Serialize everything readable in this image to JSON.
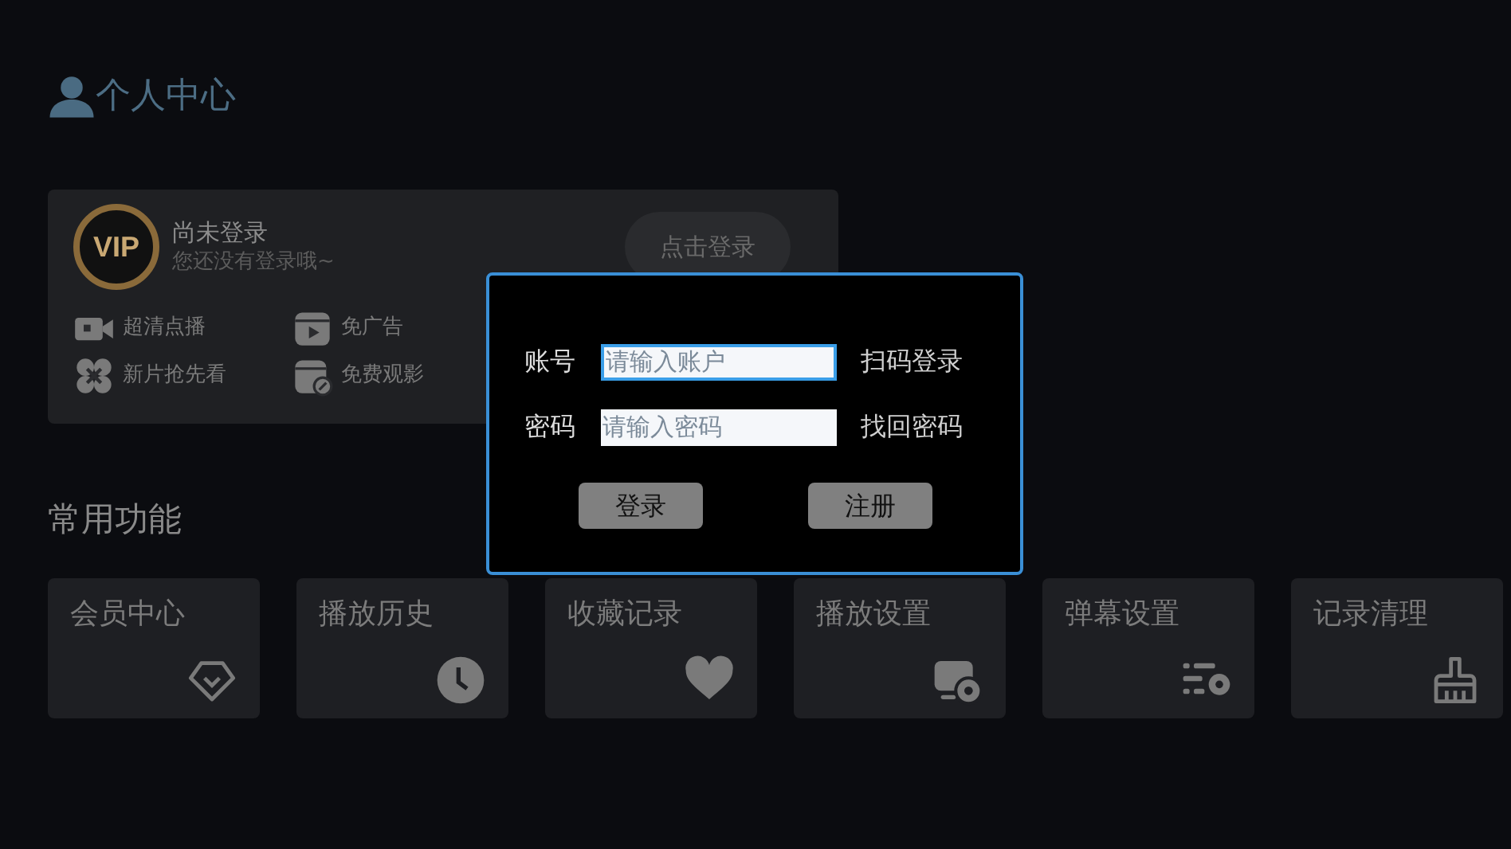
{
  "header": {
    "title": "个人中心"
  },
  "account_card": {
    "badge": "VIP",
    "status": "尚未登录",
    "subtitle": "您还没有登录哦~",
    "login_button": "点击登录",
    "perks": [
      {
        "kind": "camera",
        "label": "超清点播"
      },
      {
        "kind": "play",
        "label": "免广告"
      },
      {
        "kind": "clover",
        "label": "新片抢先看"
      },
      {
        "kind": "ticket",
        "label": "免费观影"
      }
    ]
  },
  "login_dialog": {
    "fields": [
      {
        "label": "账号",
        "placeholder": "请输入账户",
        "focused": true,
        "link": "扫码登录"
      },
      {
        "label": "密码",
        "placeholder": "请输入密码",
        "focused": false,
        "link": "找回密码"
      }
    ],
    "buttons": [
      "登录",
      "注册"
    ]
  },
  "functions": {
    "title": "常用功能",
    "items": [
      {
        "kind": "diamond",
        "label": "会员中心"
      },
      {
        "kind": "clock",
        "label": "播放历史"
      },
      {
        "kind": "heart",
        "label": "收藏记录"
      },
      {
        "kind": "screen",
        "label": "播放设置"
      },
      {
        "kind": "danmaku",
        "label": "弹幕设置"
      },
      {
        "kind": "broom",
        "label": "记录清理"
      }
    ]
  }
}
